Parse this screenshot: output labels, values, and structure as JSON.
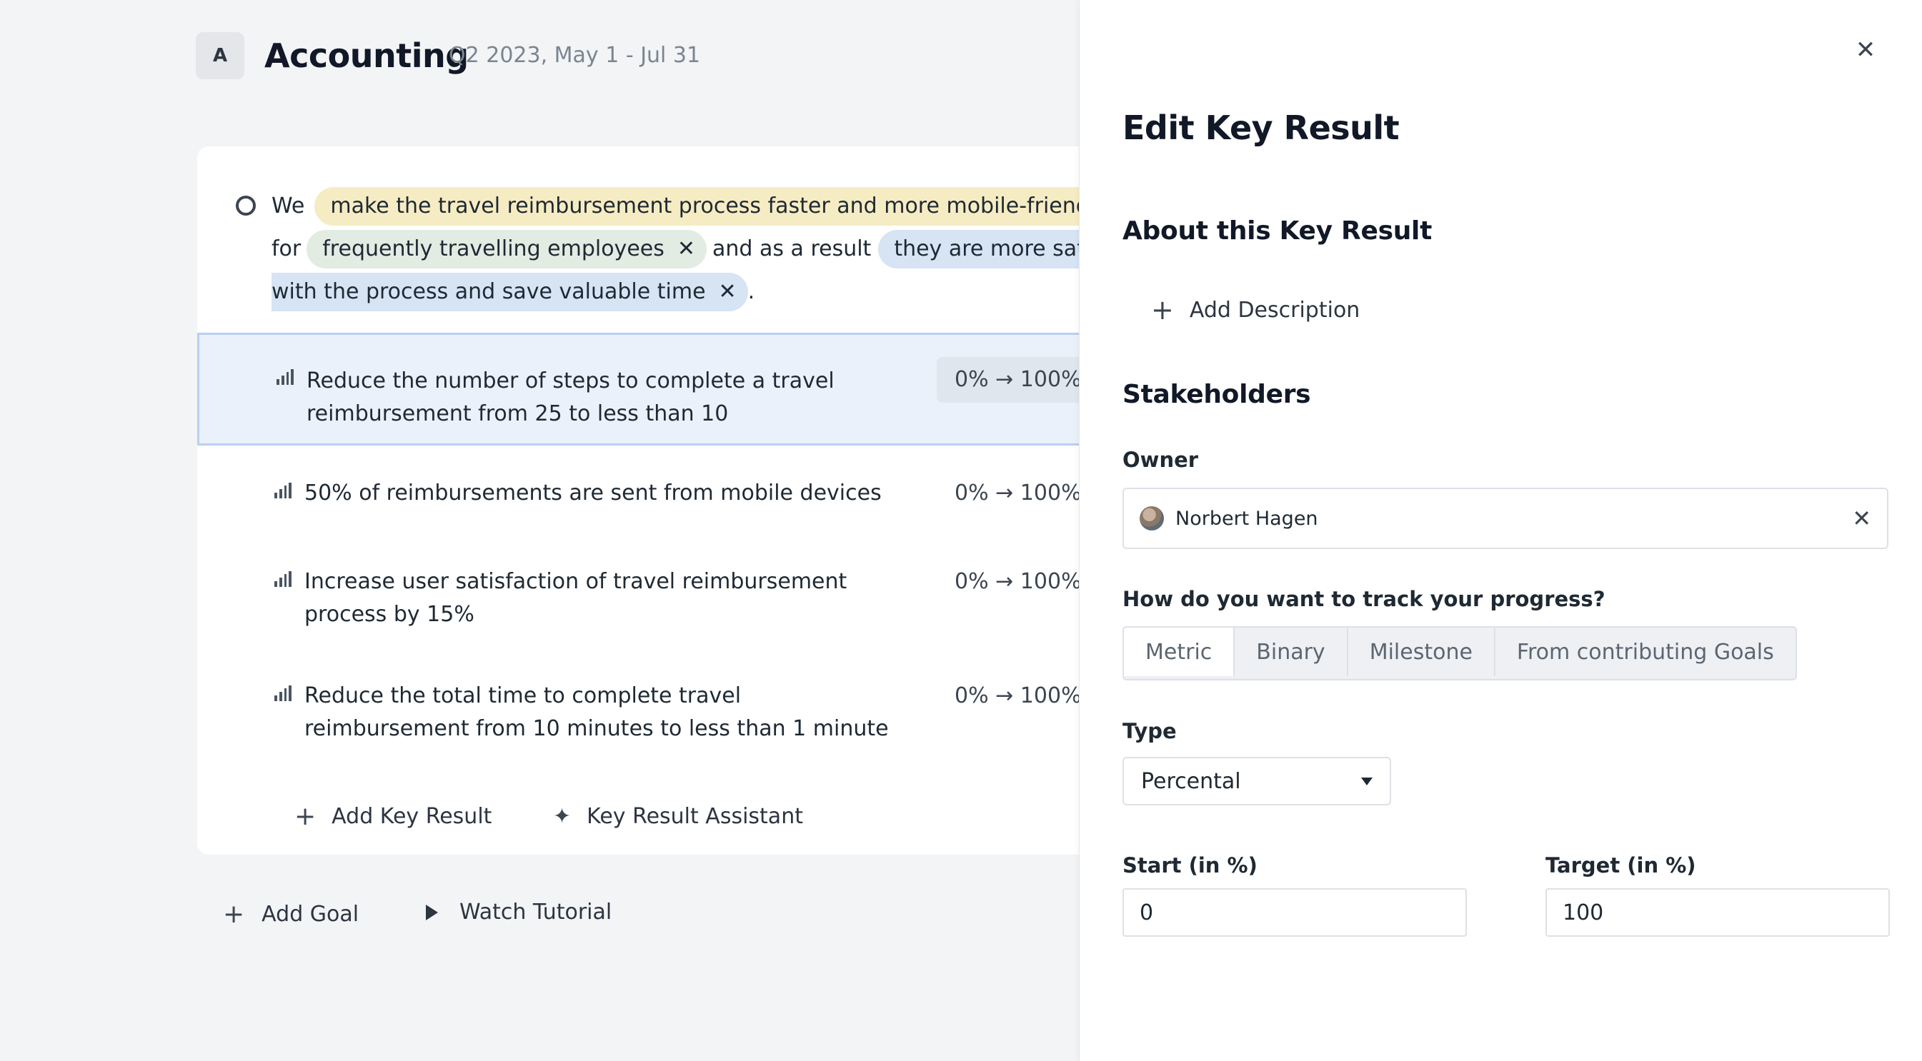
{
  "header": {
    "avatar_letter": "A",
    "team_name": "Accounting",
    "period": "Q2 2023, May 1 - Jul 31"
  },
  "goal": {
    "line1_prefix": "We",
    "chip_action": "make the travel reimbursement process faster and more mobile-friendly",
    "line2_prefix": "for",
    "chip_audience": "frequently travelling employees",
    "line2_middle": "and as a result",
    "chip_result_part1": "they are more satisfied",
    "chip_result_part2": "with the process and save valuable time",
    "line3_suffix": ".",
    "remove_glyph": "✕"
  },
  "key_results": [
    {
      "title": "Reduce the number of steps to complete a travel reimbursement from 25 to less than 10",
      "progress": "0% → 100%",
      "selected": true
    },
    {
      "title": "50% of reimbursements are sent from mobile devices",
      "progress": "0% → 100%",
      "selected": false
    },
    {
      "title": "Increase user satisfaction of travel reimbursement process by 15%",
      "progress": "0% → 100%",
      "selected": false
    },
    {
      "title": "Reduce the total time to complete travel reimbursement from 10 minutes to less than 1 minute",
      "progress": "0% → 100%",
      "selected": false
    }
  ],
  "card_actions": {
    "add_key_result": "Add Key Result",
    "key_result_assistant": "Key Result Assistant"
  },
  "page_actions": {
    "add_goal": "Add Goal",
    "watch_tutorial": "Watch Tutorial"
  },
  "drawer": {
    "title": "Edit Key Result",
    "about_title": "About this Key Result",
    "add_description": "Add Description",
    "stakeholders_title": "Stakeholders",
    "owner_label": "Owner",
    "owner_name": "Norbert Hagen",
    "track_label": "How do you want to track your progress?",
    "track_options": [
      "Metric",
      "Binary",
      "Milestone",
      "From contributing Goals"
    ],
    "track_selected": "Metric",
    "type_label": "Type",
    "type_value": "Percental",
    "start_label": "Start (in %)",
    "start_value": "0",
    "target_label": "Target (in %)",
    "target_value": "100"
  },
  "icons": {
    "close": "close-icon",
    "plus": "plus-icon",
    "sparkle": "sparkle-icon",
    "play": "play-icon",
    "bars": "bar-chart-icon",
    "caret": "caret-down-icon"
  },
  "colors": {
    "chip_yellow": "#f6ecc3",
    "chip_green": "#e2ece3",
    "chip_blue": "#d6e4f4",
    "selected_row": "#eaf1fb"
  }
}
